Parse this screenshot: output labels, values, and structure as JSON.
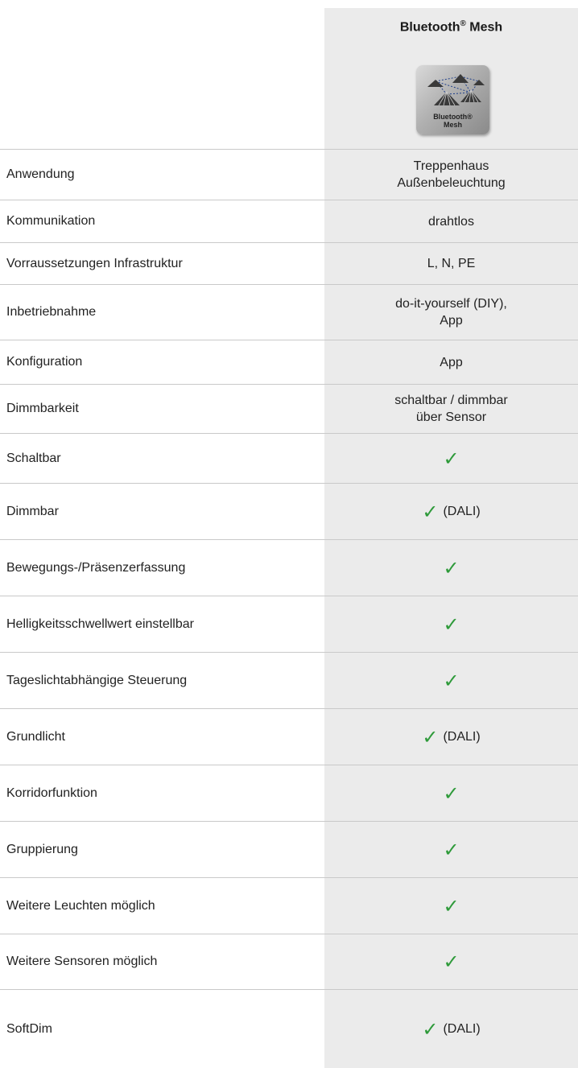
{
  "header": {
    "column_title": "Bluetooth",
    "column_title_sup": "®",
    "column_title_rest": " Mesh",
    "logo_line1": "Bluetooth®",
    "logo_line2": "Mesh"
  },
  "check_symbol": "✓",
  "check_color": "#2e9a3a",
  "rows": [
    {
      "label": "Anwendung",
      "value_line1": "Treppenhaus",
      "value_line2": "Außenbeleuchtung"
    },
    {
      "label": "Kommunikation",
      "value_line1": "drahtlos"
    },
    {
      "label": "Vorraussetzungen Infrastruktur",
      "value_line1": "L, N, PE"
    },
    {
      "label": "Inbetriebnahme",
      "value_line1": "do-it-yourself (DIY),",
      "value_line2": "App"
    },
    {
      "label": "Konfiguration",
      "value_line1": "App"
    },
    {
      "label": "Dimmbarkeit",
      "value_line1": "schaltbar / dimmbar",
      "value_line2": "über Sensor"
    },
    {
      "label": "Schaltbar",
      "check": true
    },
    {
      "label": "Dimmbar",
      "check": true,
      "note": "(DALI)"
    },
    {
      "label": "Bewegungs-/Präsenzerfassung",
      "check": true
    },
    {
      "label": "Helligkeitsschwellwert einstellbar",
      "check": true
    },
    {
      "label": "Tageslichtabhängige Steuerung",
      "check": true
    },
    {
      "label": "Grundlicht",
      "check": true,
      "note": "(DALI)"
    },
    {
      "label": "Korridorfunktion",
      "check": true
    },
    {
      "label": "Gruppierung",
      "check": true
    },
    {
      "label": "Weitere Leuchten möglich",
      "check": true
    },
    {
      "label": "Weitere Sensoren möglich",
      "check": true
    },
    {
      "label": "SoftDim",
      "check": true,
      "note": "(DALI)"
    }
  ]
}
